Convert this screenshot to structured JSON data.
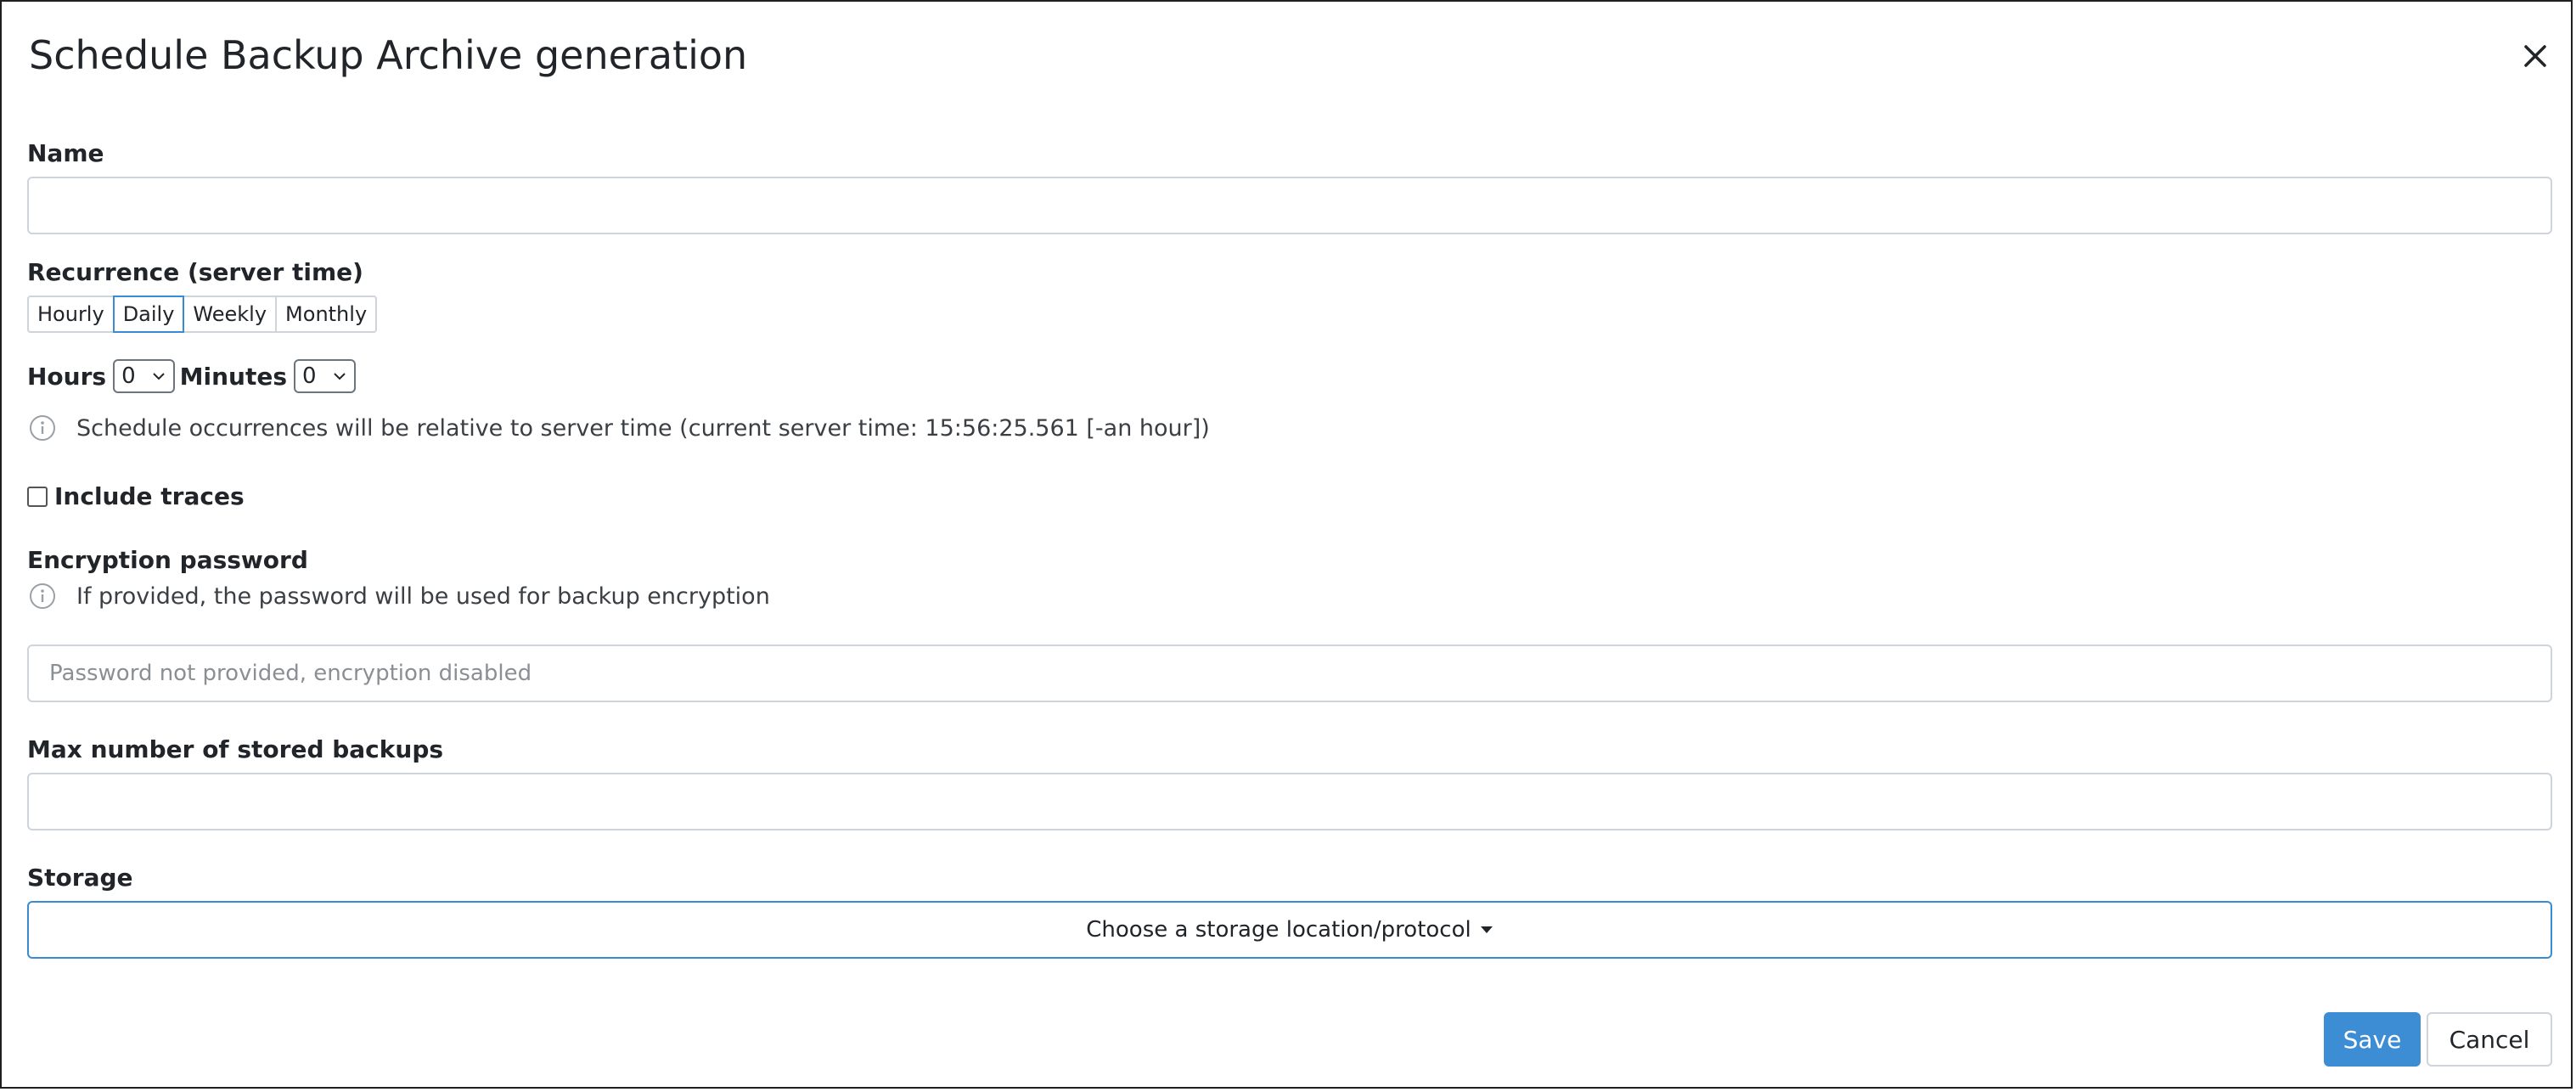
{
  "dialog": {
    "title": "Schedule Backup Archive generation"
  },
  "name": {
    "label": "Name",
    "value": ""
  },
  "recurrence": {
    "label": "Recurrence (server time)",
    "options": [
      "Hourly",
      "Daily",
      "Weekly",
      "Monthly"
    ],
    "selected": "Daily"
  },
  "time": {
    "hours_label": "Hours",
    "hours_value": "0",
    "minutes_label": "Minutes",
    "minutes_value": "0"
  },
  "schedule_info": "Schedule occurrences will be relative to server time (current server time: 15:56:25.561 [-an hour])",
  "traces": {
    "label": "Include traces",
    "checked": false
  },
  "encryption": {
    "label": "Encryption password",
    "info": "If provided, the password will be used for backup encryption",
    "placeholder": "Password not provided, encryption disabled"
  },
  "max_backups": {
    "label": "Max number of stored backups",
    "value": ""
  },
  "storage": {
    "label": "Storage",
    "button_label": "Choose a storage location/protocol"
  },
  "actions": {
    "save_label": "Save",
    "cancel_label": "Cancel"
  },
  "colors": {
    "accent": "#3a8bd4",
    "primary_button": "#3d8dd4",
    "border": "#ced4da",
    "text": "#212529"
  },
  "icons": {
    "close": "close-icon",
    "info": "info-icon",
    "caret": "chevron-down-icon",
    "dropdown": "caret-down-icon"
  }
}
